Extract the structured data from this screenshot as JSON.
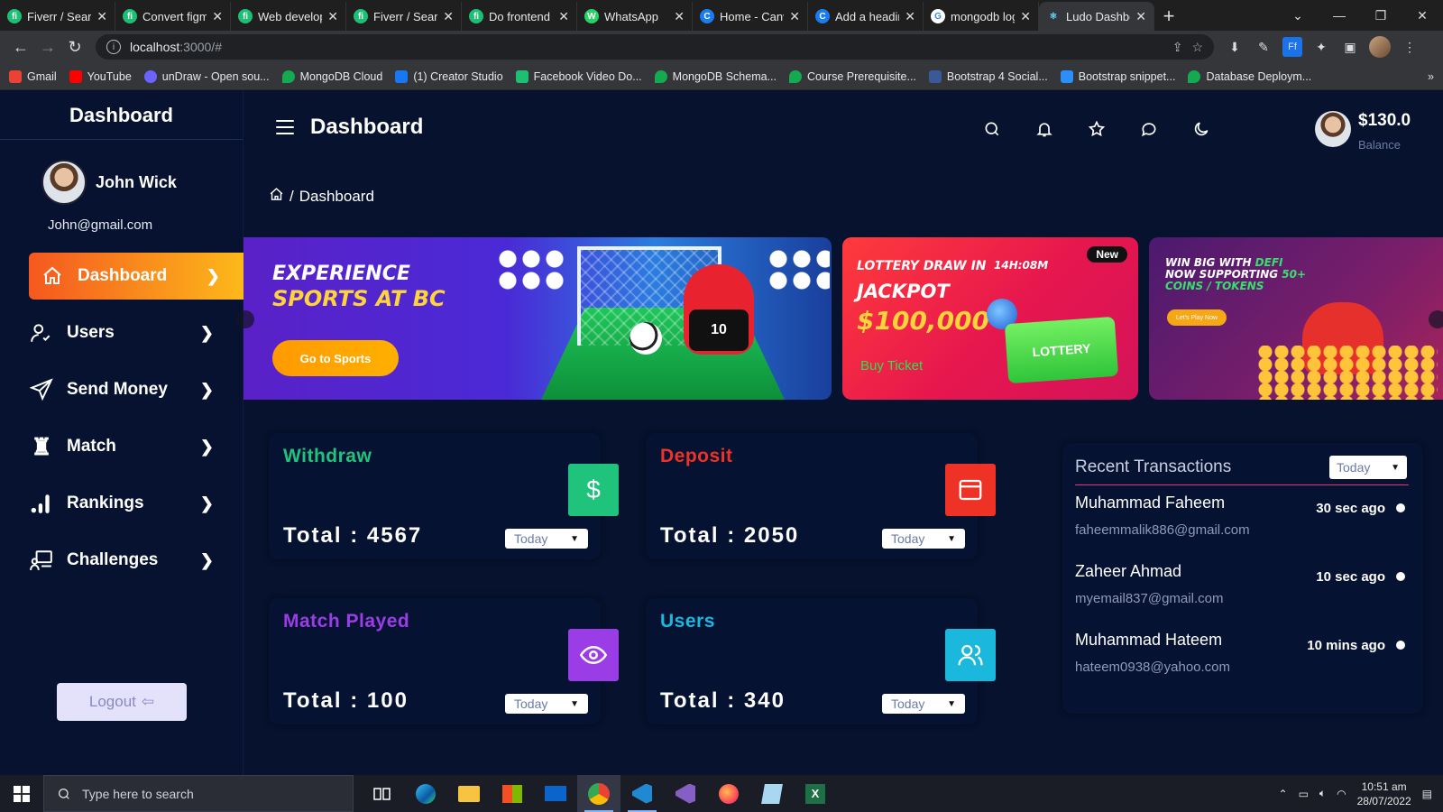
{
  "browser": {
    "tabs": [
      {
        "title": "Fiverr / Search",
        "fav_color": "#1dbf73",
        "fav_char": "fi"
      },
      {
        "title": "Convert figma",
        "fav_color": "#1dbf73",
        "fav_char": "fi"
      },
      {
        "title": "Web developer",
        "fav_color": "#1dbf73",
        "fav_char": "fi"
      },
      {
        "title": "Fiverr / Search",
        "fav_color": "#1dbf73",
        "fav_char": "fi"
      },
      {
        "title": "Do frontend",
        "fav_color": "#1dbf73",
        "fav_char": "fi"
      },
      {
        "title": "WhatsApp",
        "fav_color": "#25d366",
        "fav_char": "W"
      },
      {
        "title": "Home - Canva",
        "fav_color": "#00c4cc",
        "fav_char": "C"
      },
      {
        "title": "Add a heading",
        "fav_color": "#00c4cc",
        "fav_char": "C"
      },
      {
        "title": "mongodb login",
        "fav_color": "#ffffff",
        "fav_char": "G"
      },
      {
        "title": "Ludo Dashboard",
        "fav_color": "#61dafb",
        "fav_char": "⚛"
      }
    ],
    "url_host": "localhost",
    "url_rest": ":3000/#",
    "bookmarks": [
      {
        "label": "Gmail",
        "color": "#ea4335"
      },
      {
        "label": "YouTube",
        "color": "#ff0000"
      },
      {
        "label": "unDraw - Open sou...",
        "color": "#6c63ff"
      },
      {
        "label": "MongoDB Cloud",
        "color": "#13aa52"
      },
      {
        "label": "(1) Creator Studio",
        "color": "#1877f2"
      },
      {
        "label": "Facebook Video Do...",
        "color": "#1dbf73"
      },
      {
        "label": "MongoDB Schema...",
        "color": "#13aa52"
      },
      {
        "label": "Course Prerequisite...",
        "color": "#13aa52"
      },
      {
        "label": "Bootstrap 4 Social...",
        "color": "#3b5998"
      },
      {
        "label": "Bootstrap snippet...",
        "color": "#2c8ef8"
      },
      {
        "label": "Database Deploym...",
        "color": "#13aa52"
      }
    ]
  },
  "sidebar": {
    "logo": "Dashboard",
    "user_name": "John Wick",
    "user_email": "John@gmail.com",
    "menu": [
      {
        "label": "Dashboard",
        "icon": "home-icon",
        "active": true
      },
      {
        "label": "Users",
        "icon": "users-icon"
      },
      {
        "label": "Send Money",
        "icon": "send-icon"
      },
      {
        "label": "Match",
        "icon": "chess-icon"
      },
      {
        "label": "Rankings",
        "icon": "bar-chart-icon"
      },
      {
        "label": "Challenges",
        "icon": "presentation-icon"
      }
    ],
    "logout_label": "Logout"
  },
  "header": {
    "title": "Dashboard",
    "balance": "$130.0",
    "balance_label": "Balance"
  },
  "breadcrumb": {
    "current": "Dashboard"
  },
  "banners": {
    "sports": {
      "line1": "EXPERIENCE",
      "line2": "SPORTS AT BC",
      "button": "Go to Sports",
      "jersey": "10"
    },
    "lottery": {
      "badge": "New",
      "line1": "LOTTERY DRAW IN",
      "timer": "14H:08M",
      "line2": "JACKPOT",
      "amount": "$100,000",
      "cta": "Buy Ticket",
      "ticket": "LOTTERY"
    },
    "defi": {
      "line1a": "WIN BIG WITH ",
      "line1b": "DEFI",
      "line2a": "NOW SUPPORTING ",
      "line2b": "50+",
      "line3": "COINS / TOKENS",
      "button": "Let's Play Now"
    }
  },
  "stats": [
    {
      "title": "Withdraw",
      "total": "Total : 4567",
      "period": "Today",
      "color": "#1fc37b",
      "icon": "dollar-icon"
    },
    {
      "title": "Deposit",
      "total": "Total : 2050",
      "period": "Today",
      "color": "#ee3326",
      "icon": "window-icon"
    },
    {
      "title": "Match Played",
      "total": "Total : 100",
      "period": "Today",
      "color": "#9b3de6",
      "icon": "eye-icon"
    },
    {
      "title": "Users",
      "total": "Total : 340",
      "period": "Today",
      "color": "#1ab8dc",
      "icon": "users-icon"
    }
  ],
  "transactions": {
    "title": "Recent Transactions",
    "period": "Today",
    "items": [
      {
        "name": "Muhammad Faheem",
        "email": "faheemmalik886@gmail.com",
        "time": "30 sec ago"
      },
      {
        "name": "Zaheer Ahmad",
        "email": "myemail837@gmail.com",
        "time": "10 sec ago"
      },
      {
        "name": "Muhammad Hateem",
        "email": "hateem0938@yahoo.com",
        "time": "10 mins ago"
      }
    ]
  },
  "taskbar": {
    "search_placeholder": "Type here to search",
    "time": "10:51 am",
    "date": "28/07/2022"
  }
}
